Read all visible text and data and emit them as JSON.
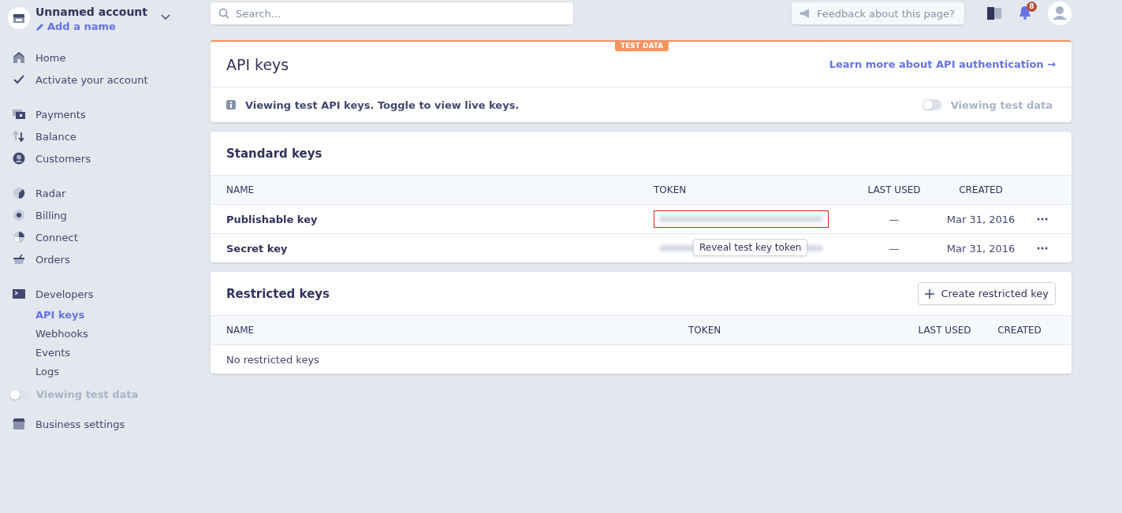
{
  "account": {
    "name": "Unnamed account",
    "action": "Add a name"
  },
  "nav_groups": [
    {
      "items": [
        {
          "label": "Home",
          "selected": false
        },
        {
          "label": "Activate your account",
          "selected": false
        }
      ]
    },
    {
      "items": [
        {
          "label": "Payments",
          "selected": false
        },
        {
          "label": "Balance",
          "selected": false
        },
        {
          "label": "Customers",
          "selected": false
        }
      ]
    },
    {
      "items": [
        {
          "label": "Radar",
          "selected": false
        },
        {
          "label": "Billing",
          "selected": false
        },
        {
          "label": "Connect",
          "selected": false
        },
        {
          "label": "Orders",
          "selected": false
        }
      ]
    },
    {
      "items": [
        {
          "label": "Developers",
          "selected": false,
          "children": [
            {
              "label": "API keys",
              "selected": true
            },
            {
              "label": "Webhooks",
              "selected": false
            },
            {
              "label": "Events",
              "selected": false
            },
            {
              "label": "Logs",
              "selected": false
            }
          ]
        }
      ]
    }
  ],
  "sidebar_toggle": {
    "label": "Viewing test data",
    "on": false
  },
  "business_settings": {
    "label": "Business settings"
  },
  "search": {
    "placeholder": "Search..."
  },
  "feedback": {
    "placeholder": "Feedback about this page?"
  },
  "notifications": {
    "count": "8"
  },
  "header_card": {
    "badge": "TEST DATA",
    "title": "API keys",
    "link": "Learn more about API authentication →",
    "notice": "Viewing test API keys. Toggle to view live keys.",
    "toggle": {
      "label": "Viewing test data",
      "on": false
    }
  },
  "standard_keys": {
    "title": "Standard keys",
    "columns": [
      "NAME",
      "TOKEN",
      "LAST USED",
      "CREATED"
    ],
    "rows": [
      {
        "name": "Publishable key",
        "last_used": "—",
        "created": "Mar 31, 2016",
        "highlighted": true
      },
      {
        "name": "Secret key",
        "last_used": "—",
        "created": "Mar 31, 2016",
        "highlighted": false,
        "tooltip": "Reveal test key token"
      }
    ]
  },
  "restricted_keys": {
    "title": "Restricted keys",
    "button": "Create restricted key",
    "columns": [
      "NAME",
      "TOKEN",
      "LAST USED",
      "CREATED"
    ],
    "empty": "No restricted keys"
  }
}
